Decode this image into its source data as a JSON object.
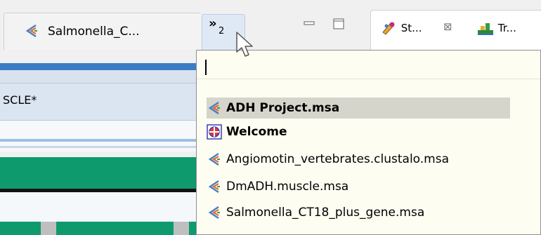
{
  "editor_tab": {
    "label": "Salmonella_C..."
  },
  "overflow_button": {
    "chevron": "»",
    "count": "2"
  },
  "window_controls": {
    "minimize_icon": "minimize-icon",
    "maximize_icon": "maximize-icon"
  },
  "side_tabs": [
    {
      "label": "St...",
      "icon": "styles-icon"
    },
    {
      "label": "Tr...",
      "icon": "tree-icon"
    }
  ],
  "side_tab_close": "⊠",
  "editor": {
    "title": "SCLE*"
  },
  "popup": {
    "filter_value": "",
    "items": [
      {
        "label": "ADH Project.msa",
        "icon": "msa-file-icon",
        "bold": true,
        "selected": true
      },
      {
        "label": "Welcome",
        "icon": "welcome-icon",
        "bold": true,
        "selected": false
      },
      {
        "label": "Angiomotin_vertebrates.clustalo.msa",
        "icon": "msa-file-icon",
        "bold": false,
        "selected": false
      },
      {
        "label": "DmADH.muscle.msa",
        "icon": "msa-file-icon",
        "bold": false,
        "selected": false
      },
      {
        "label": "Salmonella_CT18_plus_gene.msa",
        "icon": "msa-file-icon",
        "bold": false,
        "selected": false
      }
    ]
  },
  "colors": {
    "accent_blue": "#3c7cc5",
    "sequence_green": "#0f9a6e",
    "popup_bg": "#fdfdf2",
    "selection": "#d6d5cc"
  }
}
